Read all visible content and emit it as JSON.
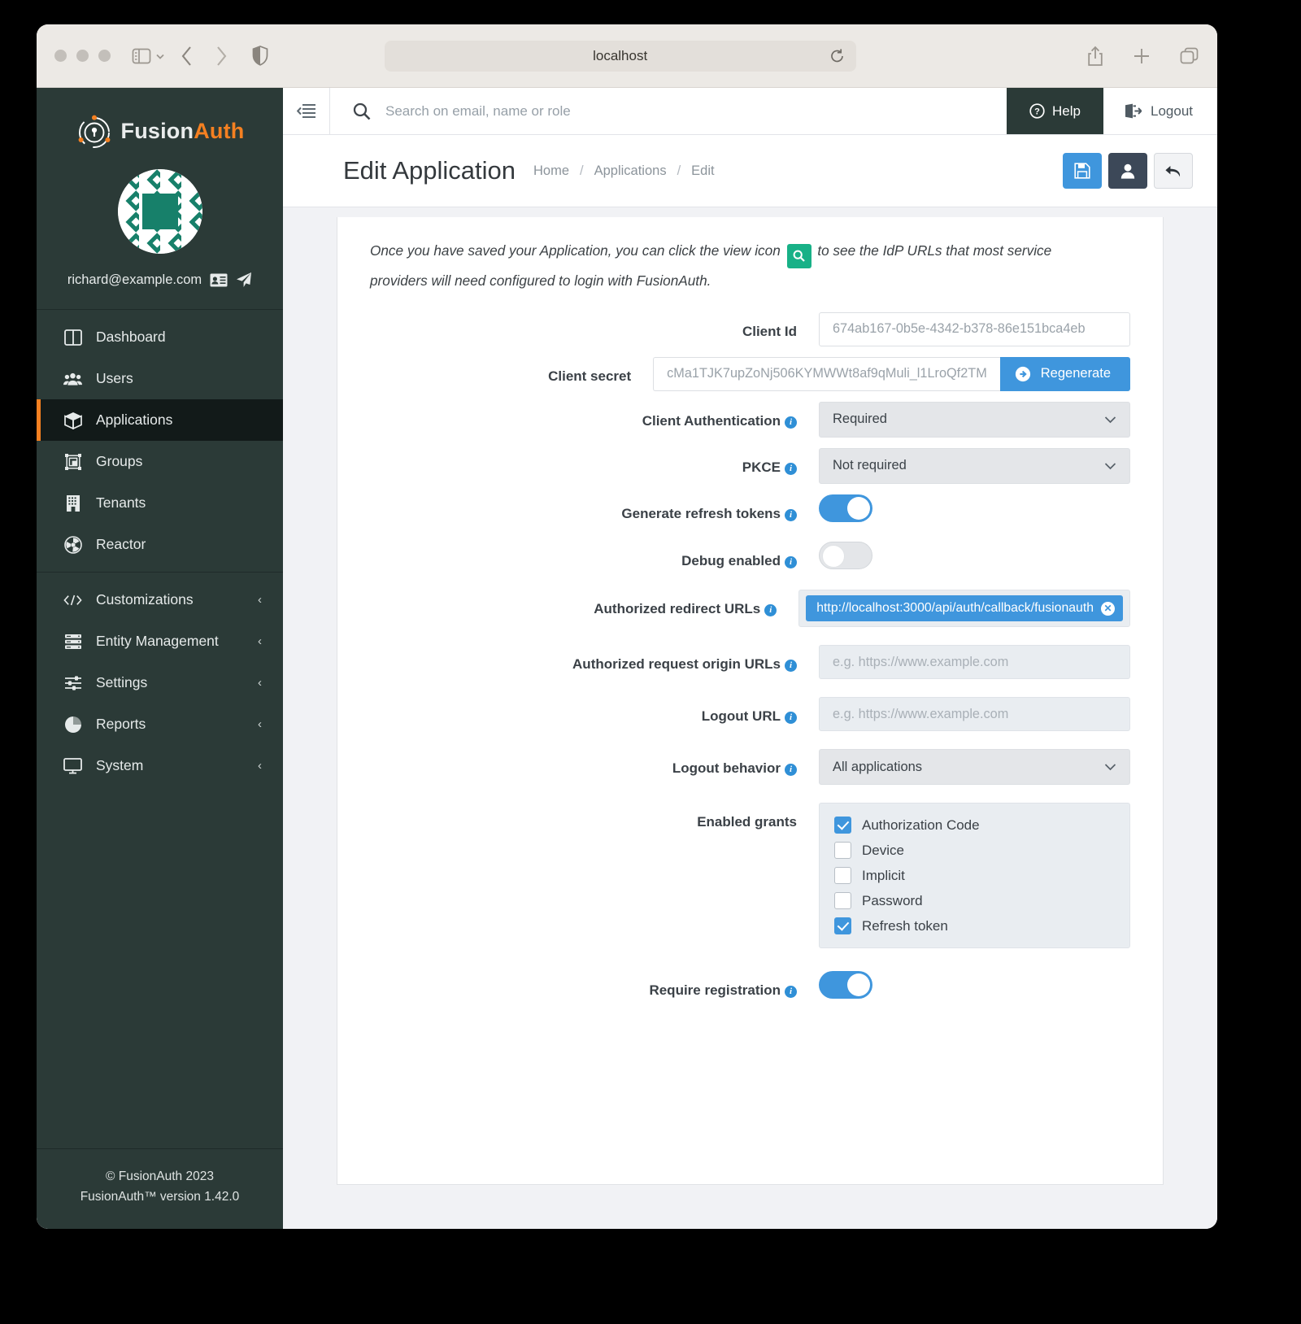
{
  "browser": {
    "url": "localhost",
    "icons": {
      "sidebar": "sidebar-toggle-icon",
      "chevron": "chevron-down-icon",
      "back": "back-arrow-icon",
      "forward": "forward-arrow-icon",
      "shield": "shield-icon",
      "reload": "reload-icon",
      "share": "share-icon",
      "new_tab": "plus-icon",
      "tabs": "tab-overview-icon"
    }
  },
  "sidebar": {
    "brand": {
      "first": "Fusion",
      "second": "Auth"
    },
    "user_email": "richard@example.com",
    "groups": [
      {
        "items": [
          {
            "label": "Dashboard",
            "icon": "dashboard-icon",
            "active": false,
            "expandable": false
          },
          {
            "label": "Users",
            "icon": "users-icon",
            "active": false,
            "expandable": false
          },
          {
            "label": "Applications",
            "icon": "applications-box-icon",
            "active": true,
            "expandable": false
          },
          {
            "label": "Groups",
            "icon": "groups-icon",
            "active": false,
            "expandable": false
          },
          {
            "label": "Tenants",
            "icon": "tenants-building-icon",
            "active": false,
            "expandable": false
          },
          {
            "label": "Reactor",
            "icon": "reactor-icon",
            "active": false,
            "expandable": false
          }
        ]
      },
      {
        "items": [
          {
            "label": "Customizations",
            "icon": "code-icon",
            "active": false,
            "expandable": true
          },
          {
            "label": "Entity Management",
            "icon": "server-icon",
            "active": false,
            "expandable": true
          },
          {
            "label": "Settings",
            "icon": "sliders-icon",
            "active": false,
            "expandable": true
          },
          {
            "label": "Reports",
            "icon": "pie-chart-icon",
            "active": false,
            "expandable": true
          },
          {
            "label": "System",
            "icon": "monitor-icon",
            "active": false,
            "expandable": true
          }
        ]
      }
    ],
    "expand_chevron": "‹",
    "footer_line1": "© FusionAuth 2023",
    "footer_line2": "FusionAuth™ version 1.42.0"
  },
  "topbar": {
    "search_placeholder": "Search on email, name or role",
    "help_label": "Help",
    "logout_label": "Logout"
  },
  "pagehead": {
    "title": "Edit Application",
    "breadcrumb": [
      "Home",
      "Applications",
      "Edit"
    ],
    "separator": "/",
    "actions": [
      {
        "name": "save-button",
        "icon": "save-disk-icon"
      },
      {
        "name": "user-button",
        "icon": "user-icon"
      },
      {
        "name": "back-button",
        "icon": "undo-arrow-icon"
      }
    ]
  },
  "notice": {
    "part1": "Once you have saved your Application, you can click the view icon",
    "badge_icon": "search-view-icon",
    "part2": "to see the IdP URLs that most service providers will need configured to login with FusionAuth."
  },
  "form": {
    "client_id": {
      "label": "Client Id",
      "value": "674ab167-0b5e-4342-b378-86e151bca4eb"
    },
    "client_secret": {
      "label": "Client secret",
      "value": "cMa1TJK7upZoNj506KYMWWt8af9qMuli_l1LroQf2TM",
      "button": "Regenerate"
    },
    "client_authentication": {
      "label": "Client Authentication",
      "value": "Required"
    },
    "pkce": {
      "label": "PKCE",
      "value": "Not required"
    },
    "generate_refresh_tokens": {
      "label": "Generate refresh tokens",
      "on": true
    },
    "debug_enabled": {
      "label": "Debug enabled",
      "on": false
    },
    "authorized_redirect_urls": {
      "label": "Authorized redirect URLs",
      "chips": [
        "http://localhost:3000/api/auth/callback/fusionauth"
      ]
    },
    "authorized_request_origin_urls": {
      "label": "Authorized request origin URLs",
      "placeholder": "e.g. https://www.example.com"
    },
    "logout_url": {
      "label": "Logout URL",
      "placeholder": "e.g. https://www.example.com"
    },
    "logout_behavior": {
      "label": "Logout behavior",
      "value": "All applications"
    },
    "enabled_grants": {
      "label": "Enabled grants",
      "options": [
        {
          "label": "Authorization Code",
          "checked": true
        },
        {
          "label": "Device",
          "checked": false
        },
        {
          "label": "Implicit",
          "checked": false
        },
        {
          "label": "Password",
          "checked": false
        },
        {
          "label": "Refresh token",
          "checked": true
        }
      ]
    },
    "require_registration": {
      "label": "Require registration",
      "on": true
    }
  },
  "colors": {
    "accent_orange": "#f58021",
    "sidebar_bg": "#2b3a37",
    "primary_blue": "#3f96dd",
    "teal_badge": "#18b187"
  }
}
